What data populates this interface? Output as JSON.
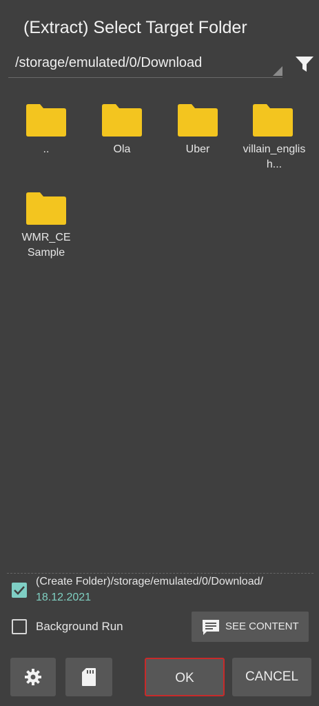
{
  "dialog": {
    "title": "(Extract) Select Target Folder",
    "path": "/storage/emulated/0/Download"
  },
  "folders": [
    {
      "name": ".."
    },
    {
      "name": "Ola"
    },
    {
      "name": "Uber"
    },
    {
      "name": "villain_english..."
    },
    {
      "name": "WMR_CE Sample"
    }
  ],
  "options": {
    "create_folder": {
      "label": "(Create Folder)/storage/emulated/0/Download/",
      "date": "18.12.2021",
      "checked": true
    },
    "background_run": {
      "label": "Background Run",
      "checked": false
    },
    "see_content": "SEE CONTENT"
  },
  "buttons": {
    "settings_icon": "gear-icon",
    "storage_icon": "sd-card-icon",
    "ok": "OK",
    "cancel": "CANCEL"
  },
  "colors": {
    "background": "#3f3f3f",
    "button": "#575757",
    "folder": "#f3c51f",
    "accent": "#7fcfc5",
    "ok_border": "#c82a2a"
  }
}
